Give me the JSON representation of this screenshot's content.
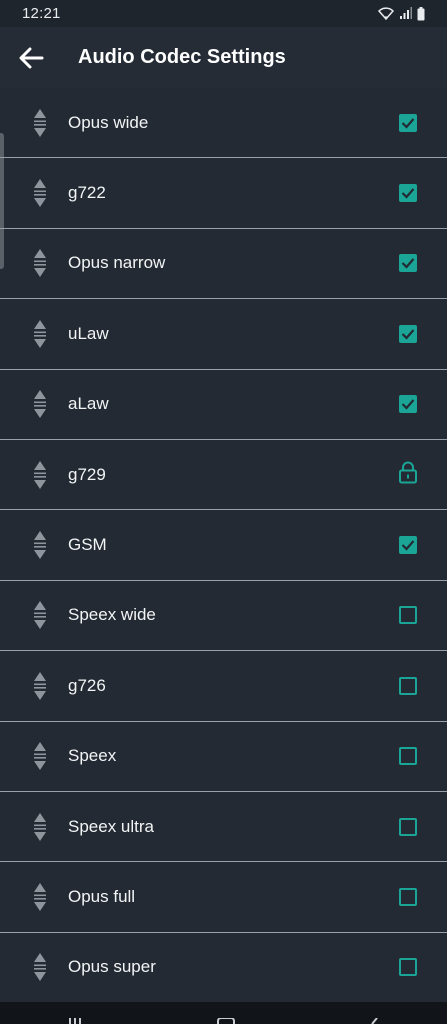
{
  "status_bar": {
    "time": "12:21"
  },
  "app_bar": {
    "title": "Audio Codec Settings"
  },
  "codecs": [
    {
      "label": "Opus wide",
      "state": "checked"
    },
    {
      "label": "g722",
      "state": "checked"
    },
    {
      "label": "Opus narrow",
      "state": "checked"
    },
    {
      "label": "uLaw",
      "state": "checked"
    },
    {
      "label": "aLaw",
      "state": "checked"
    },
    {
      "label": "g729",
      "state": "locked"
    },
    {
      "label": "GSM",
      "state": "checked"
    },
    {
      "label": "Speex wide",
      "state": "unchecked"
    },
    {
      "label": "g726",
      "state": "unchecked"
    },
    {
      "label": "Speex",
      "state": "unchecked"
    },
    {
      "label": "Speex ultra",
      "state": "unchecked"
    },
    {
      "label": "Opus full",
      "state": "unchecked"
    },
    {
      "label": "Opus super",
      "state": "unchecked"
    }
  ],
  "colors": {
    "accent": "#1aa596",
    "background": "#232a33",
    "divider": "#9aa1a8"
  }
}
